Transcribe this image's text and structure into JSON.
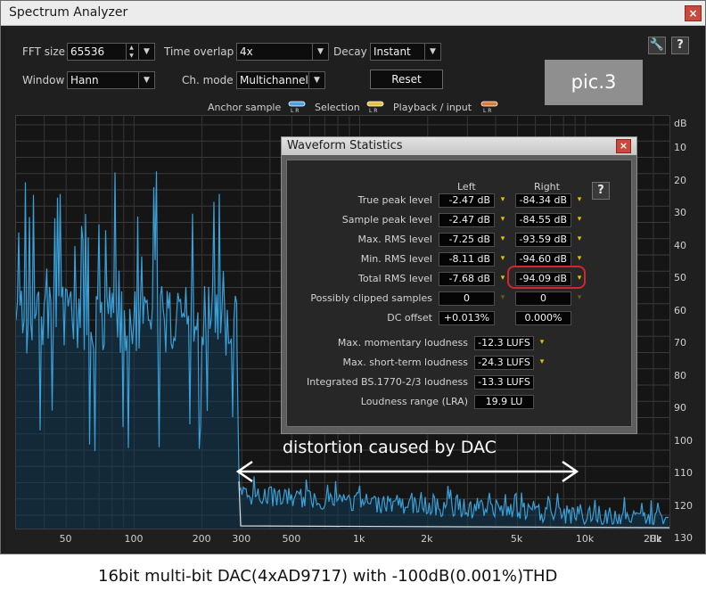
{
  "window": {
    "title": "Spectrum Analyzer",
    "close": "×"
  },
  "controls": {
    "fft_size_label": "FFT size",
    "fft_size_value": "65536",
    "time_overlap_label": "Time overlap",
    "time_overlap_value": "4x",
    "decay_label": "Decay",
    "decay_value": "Instant",
    "window_label": "Window",
    "window_value": "Hann",
    "ch_mode_label": "Ch. mode",
    "ch_mode_value": "Multichannel",
    "reset_label": "Reset",
    "dropdown_arrow": "▼",
    "spin_up": "▲",
    "spin_down": "▼"
  },
  "toolbar_icons": {
    "wrench": "🔧",
    "help": "?"
  },
  "badge": "pic.3",
  "legend": {
    "anchor_label": "Anchor sample",
    "selection_label": "Selection",
    "playback_label": "Playback / input",
    "l": "L",
    "r": "R",
    "anchor_color": "#4aa3e8",
    "selection_color": "#e8c040",
    "playback_color": "#e07a3a"
  },
  "axes": {
    "db_unit": "dB",
    "y_ticks": [
      "10",
      "20",
      "30",
      "40",
      "50",
      "60",
      "70",
      "80",
      "90",
      "100",
      "110",
      "120",
      "130"
    ],
    "x_ticks": [
      "50",
      "100",
      "200",
      "300",
      "500",
      "1k",
      "2k",
      "5k",
      "10k",
      "20k",
      "Hz"
    ]
  },
  "stats": {
    "title": "Waveform Statistics",
    "close": "×",
    "help": "?",
    "left_header": "Left",
    "right_header": "Right",
    "rows": [
      {
        "label": "True peak level",
        "left": "-2.47 dB",
        "right": "-84.34 dB"
      },
      {
        "label": "Sample peak level",
        "left": "-2.47 dB",
        "right": "-84.55 dB"
      },
      {
        "label": "Max. RMS level",
        "left": "-7.25 dB",
        "right": "-93.59 dB"
      },
      {
        "label": "Min. RMS level",
        "left": "-8.11 dB",
        "right": "-94.60 dB"
      },
      {
        "label": "Total RMS level",
        "left": "-7.68 dB",
        "right": "-94.09 dB"
      },
      {
        "label": "Possibly clipped samples",
        "left": "0",
        "right": "0"
      },
      {
        "label": "DC offset",
        "left": "+0.013%",
        "right": "0.000%"
      }
    ],
    "loudness": [
      {
        "label": "Max. momentary loudness",
        "value": "-12.3 LUFS"
      },
      {
        "label": "Max. short-term loudness",
        "value": "-24.3 LUFS"
      },
      {
        "label": "Integrated BS.1770-2/3 loudness",
        "value": "-13.3 LUFS"
      },
      {
        "label": "Loudness range (LRA)",
        "value": "19.9 LU"
      }
    ],
    "warn_glyph": "▾"
  },
  "annotation": "distortion caused by DAC",
  "caption": "16bit multi-bit DAC(4xAD9717) with -100dB(0.001%)THD",
  "colors": {
    "spectrum": "#3aa0d8",
    "floor": "#1e6f9e",
    "highlight": "#d0272d"
  }
}
